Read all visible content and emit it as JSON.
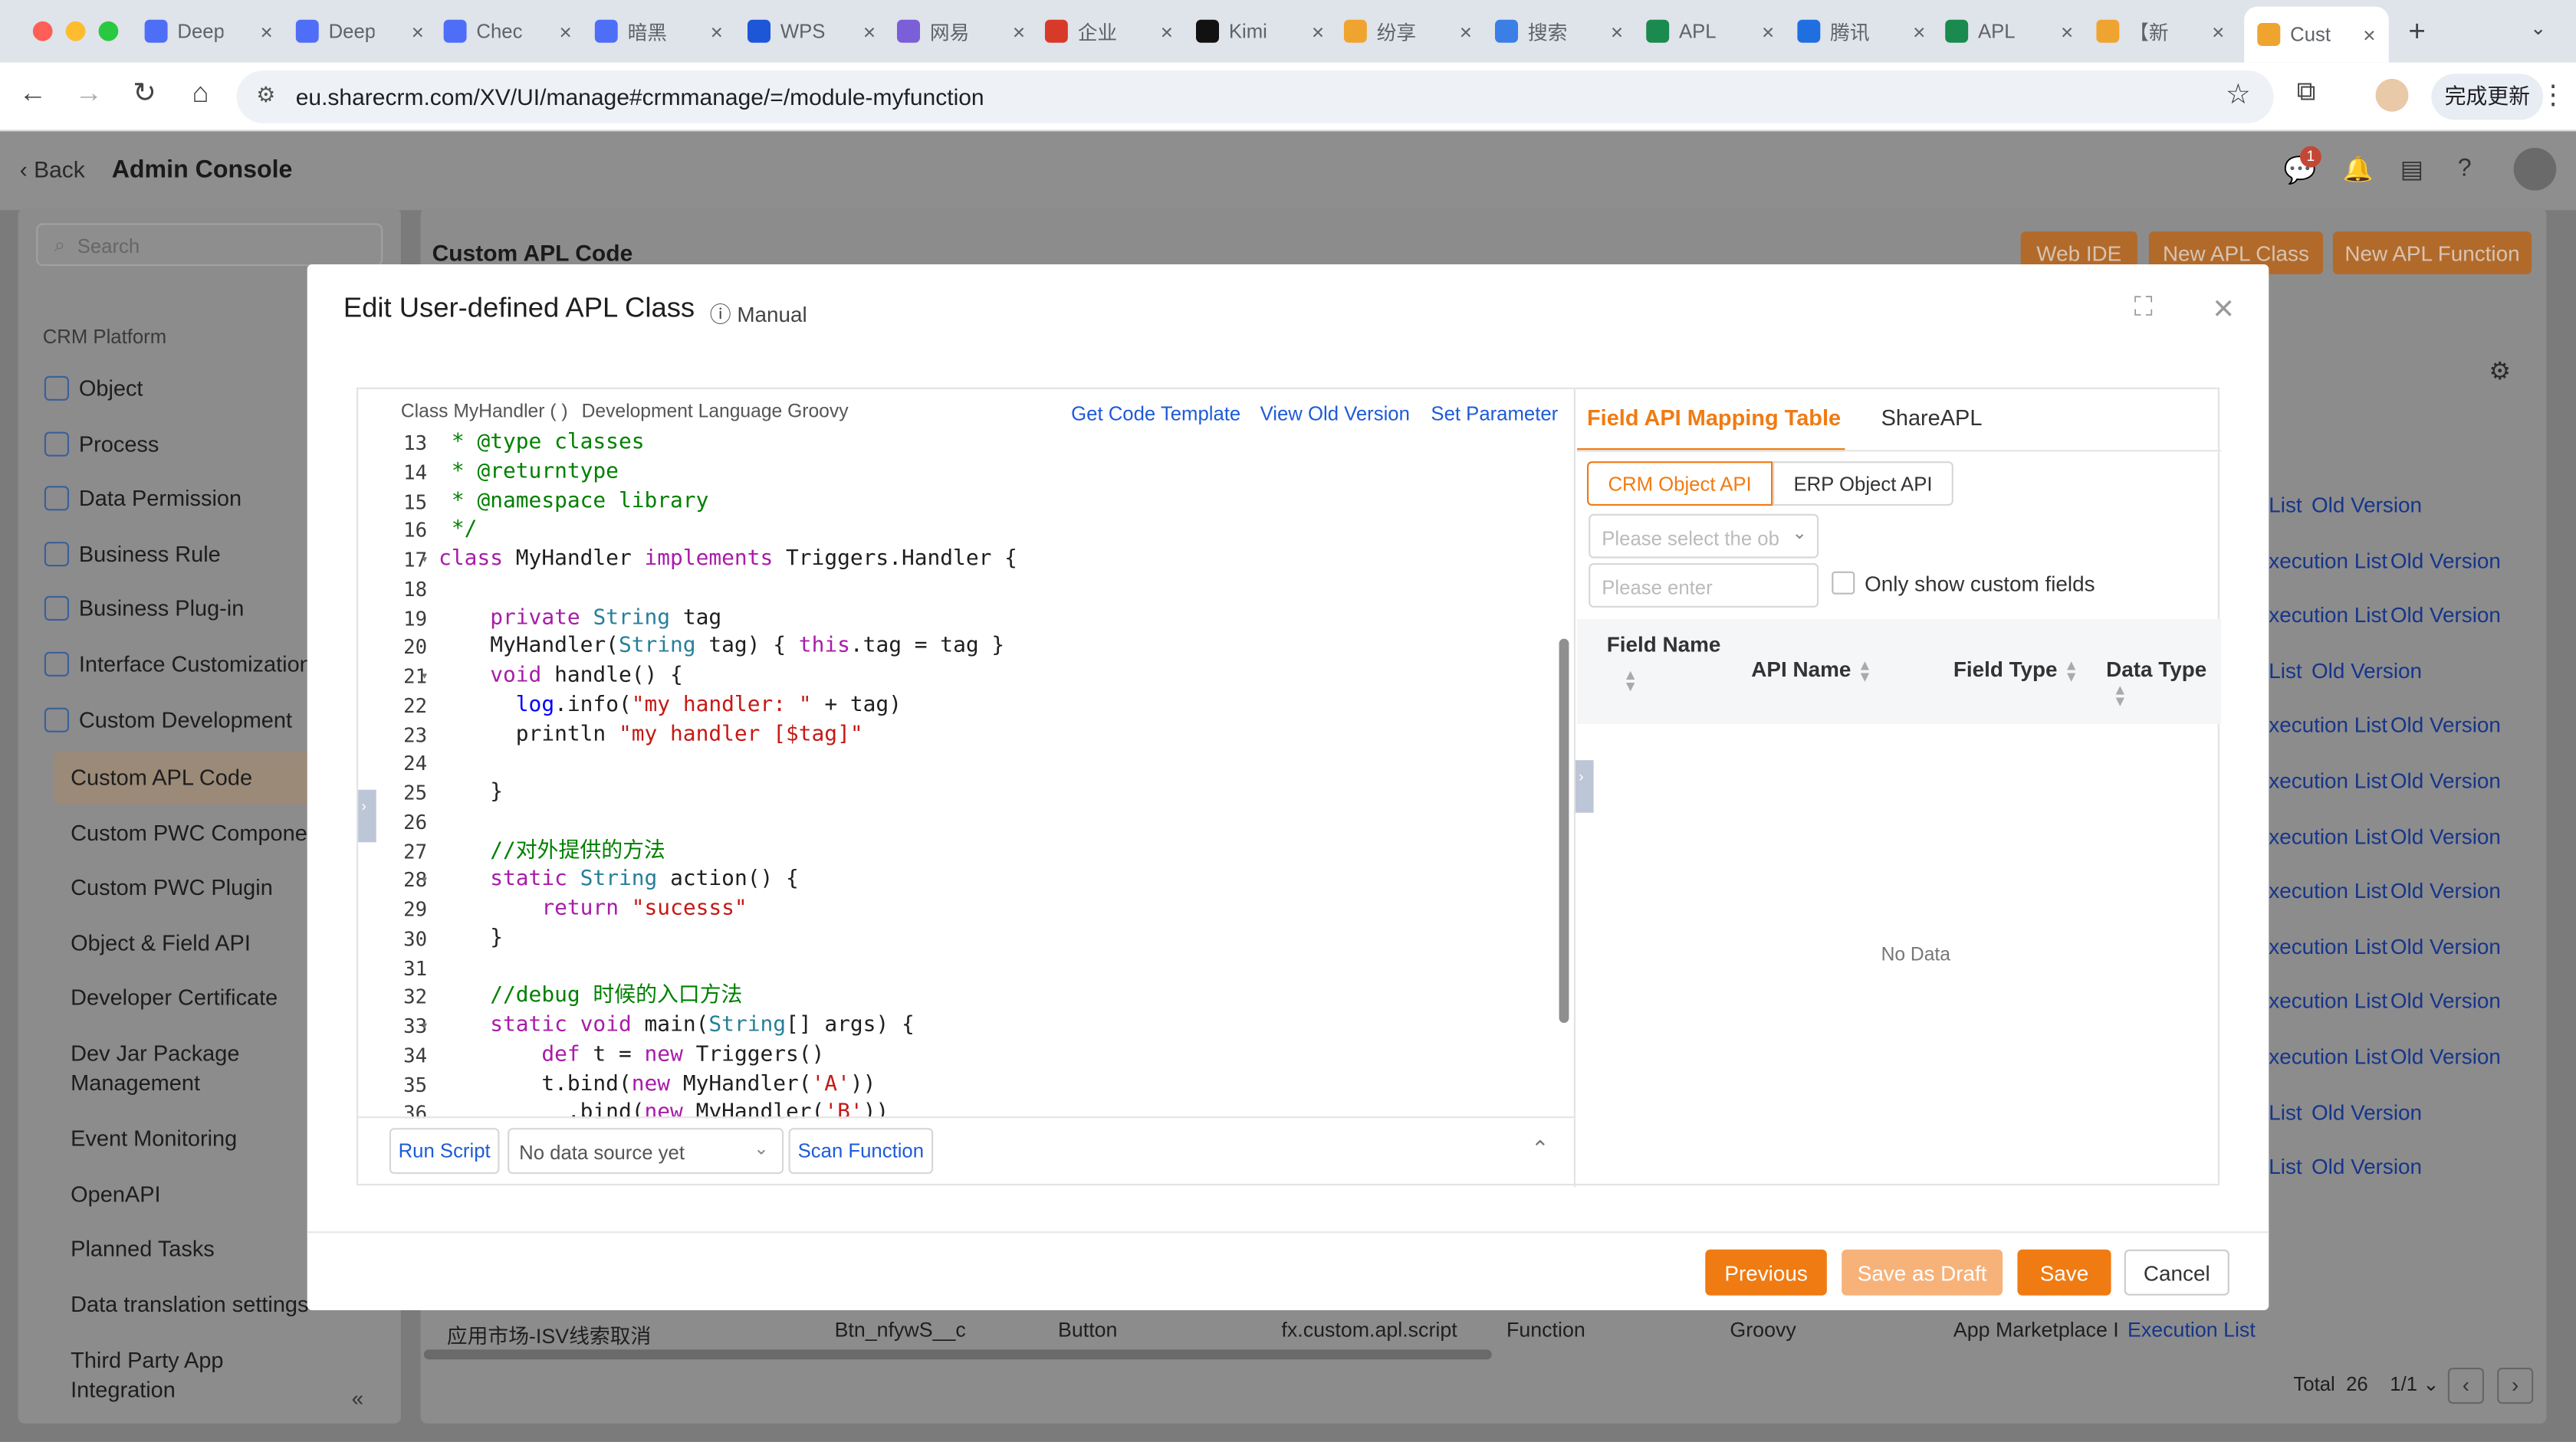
{
  "browser": {
    "tabs": [
      {
        "label": "Deep",
        "color": "#4f6ef7"
      },
      {
        "label": "Deep",
        "color": "#4f6ef7"
      },
      {
        "label": "Chec",
        "color": "#4f6ef7"
      },
      {
        "label": "暗黑",
        "color": "#4f6ef7"
      },
      {
        "label": "WPS",
        "color": "#1e56d8"
      },
      {
        "label": "网易",
        "color": "#7b5fd8"
      },
      {
        "label": "企业",
        "color": "#d83a2a"
      },
      {
        "label": "Kimi",
        "color": "#111111"
      },
      {
        "label": "纷享",
        "color": "#f0a430"
      },
      {
        "label": "搜索",
        "color": "#3b7ee6"
      },
      {
        "label": "APL",
        "color": "#1a8a4e"
      },
      {
        "label": "腾讯",
        "color": "#1f6fe0"
      },
      {
        "label": "APL",
        "color": "#1a8a4e"
      },
      {
        "label": "【新",
        "color": "#f0a430"
      },
      {
        "label": "Cust",
        "color": "#f0a430"
      }
    ],
    "url": "eu.sharecrm.com/XV/UI/manage#crmmanage/=/module-myfunction",
    "update_button": "完成更新"
  },
  "app": {
    "back": "Back",
    "title": "Admin Console",
    "notif_badge": "1",
    "search_placeholder": "Search",
    "section": "CRM Platform",
    "menu": [
      {
        "label": "Object",
        "icon": "object-icon"
      },
      {
        "label": "Process",
        "icon": "process-icon"
      },
      {
        "label": "Data Permission",
        "icon": "data-permission-icon"
      },
      {
        "label": "Business Rule",
        "icon": "business-rule-icon"
      },
      {
        "label": "Business Plug-in",
        "icon": "plugin-icon"
      },
      {
        "label": "Interface Customization",
        "icon": "interface-icon"
      },
      {
        "label": "Custom Development",
        "icon": "custom-dev-icon"
      }
    ],
    "submenu": [
      "Custom APL Code",
      "Custom PWC Componer",
      "Custom PWC Plugin",
      "Object & Field API",
      "Developer Certificate",
      "Dev Jar Package Management",
      "Event Monitoring",
      "OpenAPI",
      "Planned Tasks",
      "Data translation settings",
      "Third Party App Integration"
    ],
    "page_title": "Custom APL Code",
    "buttons": {
      "web_ide": "Web IDE",
      "new_class": "New APL Class",
      "new_function": "New APL Function"
    },
    "row_links": [
      [
        "List",
        "Old Version"
      ],
      [
        "xecution List",
        "Old Version"
      ],
      [
        "xecution List",
        "Old Version"
      ],
      [
        "List",
        "Old Version"
      ],
      [
        "xecution List",
        "Old Version"
      ],
      [
        "xecution List",
        "Old Version"
      ],
      [
        "xecution List",
        "Old Version"
      ],
      [
        "xecution List",
        "Old Version"
      ],
      [
        "xecution List",
        "Old Version"
      ],
      [
        "xecution List",
        "Old Version"
      ],
      [
        "xecution List",
        "Old Version"
      ],
      [
        "List",
        "Old Version"
      ],
      [
        "List",
        "Old Version"
      ]
    ],
    "bottom_row": [
      "应用市场-ISV线索取消",
      "Btn_nfywS__c",
      "Button",
      "fx.custom.apl.script",
      "Function",
      "Groovy",
      "App Marketplace I",
      "Execution List"
    ],
    "pagination": {
      "total_label": "Total",
      "total": "26",
      "page": "1/1"
    }
  },
  "modal": {
    "title": "Edit User-defined APL Class",
    "manual": "Manual",
    "class_label": "Class MyHandler ( )",
    "lang_label": "Development Language Groovy",
    "links": {
      "template": "Get Code Template",
      "old": "View Old Version",
      "param": "Set Parameter"
    },
    "code": [
      {
        "n": "13",
        "html": "<span class='cm'> * @type classes</span>"
      },
      {
        "n": "14",
        "html": "<span class='cm'> * @returntype</span>"
      },
      {
        "n": "15",
        "html": "<span class='cm'> * @namespace library</span>"
      },
      {
        "n": "16",
        "html": "<span class='cm'> */</span>"
      },
      {
        "n": "17",
        "fold": true,
        "html": "<span class='kw'>class</span> MyHandler <span class='kw'>implements</span> Triggers.Handler {"
      },
      {
        "n": "18",
        "html": ""
      },
      {
        "n": "19",
        "html": "    <span class='kw'>private</span> <span class='ty'>String</span> tag"
      },
      {
        "n": "20",
        "html": "    MyHandler(<span class='ty'>String</span> tag) { <span class='kw'>this</span>.tag = tag }"
      },
      {
        "n": "21",
        "fold": true,
        "html": "    <span class='kw'>void</span> handle() {"
      },
      {
        "n": "22",
        "html": "      <span class='th'>log</span>.info(<span class='st'>\"my handler: \"</span> + tag)"
      },
      {
        "n": "23",
        "html": "      println <span class='st'>\"my handler [$tag]\"</span>"
      },
      {
        "n": "24",
        "html": ""
      },
      {
        "n": "25",
        "html": "    }"
      },
      {
        "n": "26",
        "html": ""
      },
      {
        "n": "27",
        "html": "    <span class='cm'>//对外提供的方法</span>"
      },
      {
        "n": "28",
        "fold": true,
        "html": "    <span class='kw'>static</span> <span class='ty'>String</span> action() {"
      },
      {
        "n": "29",
        "html": "        <span class='kw'>return</span> <span class='st'>\"sucesss\"</span>"
      },
      {
        "n": "30",
        "html": "    }"
      },
      {
        "n": "31",
        "html": ""
      },
      {
        "n": "32",
        "html": "    <span class='cm'>//debug 时候的入口方法</span>"
      },
      {
        "n": "33",
        "fold": true,
        "html": "    <span class='kw'>static</span> <span class='kw'>void</span> main(<span class='ty'>String</span>[] args) {"
      },
      {
        "n": "34",
        "html": "        <span class='kw'>def</span> t = <span class='kw'>new</span> Triggers()"
      },
      {
        "n": "35",
        "html": "        t.bind(<span class='kw'>new</span> MyHandler(<span class='st'>'A'</span>))"
      },
      {
        "n": "36",
        "html": "          .bind(<span class='kw'>new</span> MyHandler(<span class='st'>'B'</span>))"
      }
    ],
    "run_script": "Run Script",
    "data_source": "No data source yet",
    "scan_function": "Scan Function",
    "tabs": {
      "mapping": "Field API Mapping Table",
      "share": "ShareAPL"
    },
    "seg": {
      "crm": "CRM Object API",
      "erp": "ERP Object API"
    },
    "select_placeholder": "Please select the ob",
    "enter_placeholder": "Please enter",
    "only_custom": "Only show custom fields",
    "columns": [
      "Field Name",
      "API Name",
      "Field Type",
      "Data Type"
    ],
    "no_data": "No Data",
    "footer": {
      "previous": "Previous",
      "draft": "Save as Draft",
      "save": "Save",
      "cancel": "Cancel"
    }
  }
}
